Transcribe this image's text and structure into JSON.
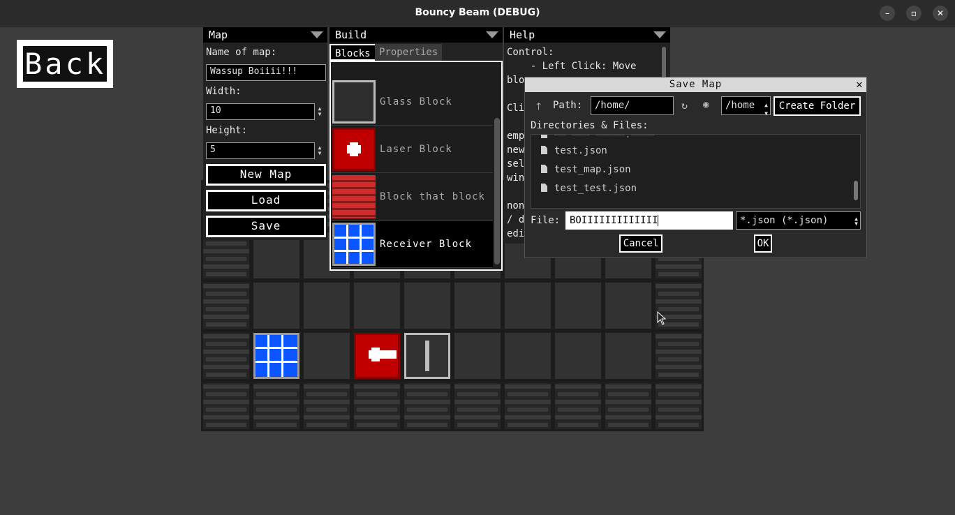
{
  "window": {
    "title": "Bouncy Beam (DEBUG)",
    "min": "–",
    "max": "▫",
    "close": "✕"
  },
  "back": {
    "label": "Back"
  },
  "map_panel": {
    "header": "Map",
    "name_label": "Name of map:",
    "name_value": "Wassup Boiiii!!!",
    "width_label": "Width:",
    "width_value": "10",
    "height_label": "Height:",
    "height_value": "5",
    "new_map": "New Map",
    "load": "Load",
    "save": "Save"
  },
  "build_panel": {
    "header": "Build",
    "tabs": [
      "Blocks",
      "Properties"
    ],
    "blocks": [
      {
        "name": "Glass Block"
      },
      {
        "name": "Laser Block"
      },
      {
        "name": "Block that block l"
      },
      {
        "name": "Receiver Block"
      }
    ]
  },
  "help_panel": {
    "header": "Help",
    "lines": [
      "Control:",
      "    - Left Click: Move",
      "blo",
      "",
      "Cli",
      "",
      "emp",
      "new",
      "sel",
      "win",
      "",
      "non",
      "/ d",
      "edi"
    ]
  },
  "dialog": {
    "title": "Save Map",
    "path_label": "Path:",
    "path_value": "/home/",
    "drive_value": "/home",
    "create_folder": "Create Folder",
    "dirs_label": "Directories & Files:",
    "files": [
      "test.json",
      "test_map.json",
      "test_test.json"
    ],
    "file_label": "File:",
    "file_value": "BOIIIIIIIIIIIII",
    "filter_value": "*.json (*.json)",
    "cancel": "Cancel",
    "ok": "OK"
  },
  "colors": {
    "red_block": "#c00000",
    "blue_block": "#0a55ff",
    "glass_border": "#bdbdbd",
    "bg": "#3d3d3d"
  }
}
